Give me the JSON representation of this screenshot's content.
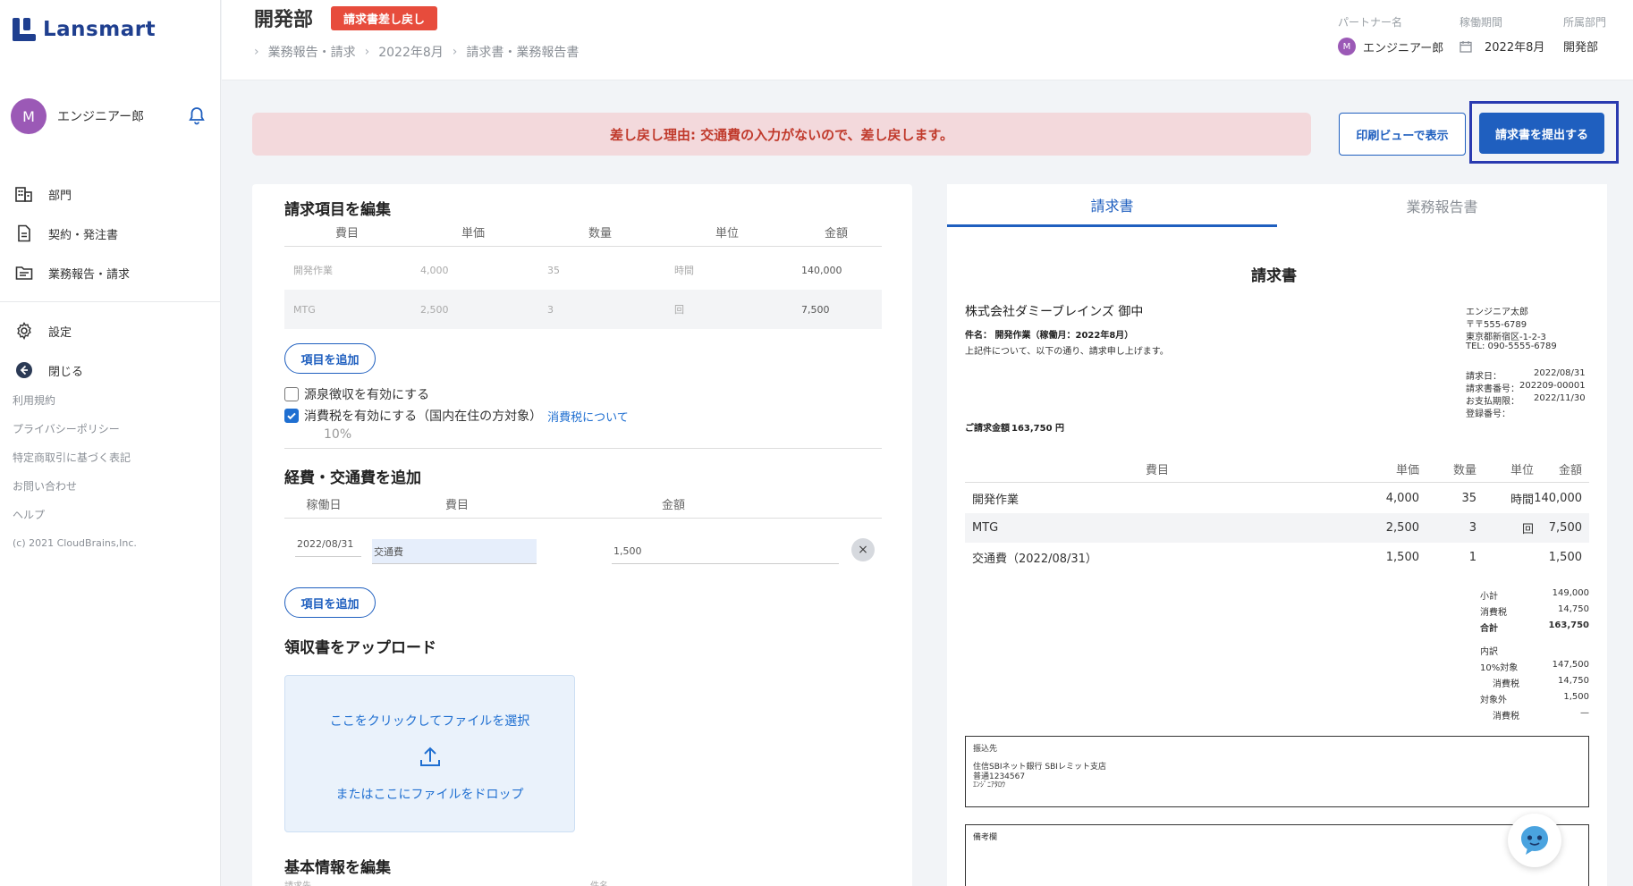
{
  "app": {
    "logo": "Lansmart"
  },
  "sidebar": {
    "user": {
      "initial": "M",
      "name": "エンジニアー郎"
    },
    "items": [
      {
        "label": "部門",
        "icon": "building-icon"
      },
      {
        "label": "契約・発注書",
        "icon": "document-icon"
      },
      {
        "label": "業務報告・請求",
        "icon": "folder-icon"
      },
      {
        "label": "設定",
        "icon": "gear-icon"
      },
      {
        "label": "閉じる",
        "icon": "arrow-left-icon"
      }
    ],
    "footer": [
      "利用規約",
      "プライバシーポリシー",
      "特定商取引に基づく表記",
      "お問い合わせ",
      "ヘルプ"
    ],
    "copyright": "(c) 2021 CloudBrains,Inc."
  },
  "header": {
    "title": "開発部",
    "status_badge": "請求書差し戻し",
    "breadcrumb": [
      "業務報告・請求",
      "2022年8月",
      "請求書・業務報告書"
    ],
    "partner_label": "パートナー名",
    "partner_initial": "M",
    "partner_name": "エンジニアー郎",
    "period_label": "稼働期間",
    "period_value": "2022年8月",
    "dept_label": "所属部門",
    "dept_value": "開発部"
  },
  "alert": {
    "text": "差し戻し理由: 交通費の入力がないので、差し戻します。"
  },
  "actions": {
    "print_view": "印刷ビューで表示",
    "submit": "請求書を提出する"
  },
  "edit_items": {
    "title": "請求項目を編集",
    "columns": [
      "費目",
      "単価",
      "数量",
      "単位",
      "金額"
    ],
    "rows": [
      {
        "item": "開発作業",
        "price": "4,000",
        "qty": "35",
        "unit": "時間",
        "amount": "140,000"
      },
      {
        "item": "MTG",
        "price": "2,500",
        "qty": "3",
        "unit": "回",
        "amount": "7,500"
      }
    ],
    "add_button": "項目を追加",
    "withholding_label": "源泉徴収を有効にする",
    "withholding_checked": false,
    "tax_label": "消費税を有効にする（国内在住の方対象）",
    "tax_checked": true,
    "tax_link": "消費税について",
    "tax_rate": "10%"
  },
  "expenses": {
    "title": "経費・交通費を追加",
    "columns": [
      "稼働日",
      "費目",
      "金額"
    ],
    "row": {
      "date": "2022/08/31",
      "item": "交通費",
      "amount": "1,500"
    },
    "add_button": "項目を追加"
  },
  "receipt": {
    "title": "領収書をアップロード",
    "click_text": "ここをクリックしてファイルを選択",
    "drop_text": "またはここにファイルをドロップ"
  },
  "basic_info": {
    "title": "基本情報を編集",
    "billing_to_label": "請求先",
    "subject_label": "件名"
  },
  "preview": {
    "tabs": [
      "請求書",
      "業務報告書"
    ],
    "doc_title": "請求書",
    "client": "株式会社ダミーブレインズ 御中",
    "subject": "件名： 開発作業（稼働月：2022年8月）",
    "intro": "上記件について、以下の通り、請求申し上げます。",
    "sender": [
      "エンジニア太郎",
      "〒〒555-6789",
      "東京都新宿区-1-2-3",
      "TEL: 090-5555-6789"
    ],
    "invoice_date_label": "請求日：",
    "invoice_date": "2022/08/31",
    "invoice_no_label": "請求書番号：",
    "invoice_no": "202209-00001",
    "due_label": "お支払期限：",
    "due_date": "2022/11/30",
    "reg_no_label": "登録番号：",
    "total_label": "ご請求金額",
    "total_value": "163,750 円",
    "columns": [
      "費目",
      "単価",
      "数量",
      "単位",
      "金額"
    ],
    "rows": [
      {
        "item": "開発作業",
        "price": "4,000",
        "qty": "35",
        "unit": "時間",
        "amount": "140,000"
      },
      {
        "item": "MTG",
        "price": "2,500",
        "qty": "3",
        "unit": "回",
        "amount": "7,500"
      },
      {
        "item": "交通費（2022/08/31）",
        "price": "1,500",
        "qty": "1",
        "unit": "",
        "amount": "1,500"
      }
    ],
    "subtotal_label": "小計",
    "subtotal": "149,000",
    "tax_label": "消費税",
    "tax": "14,750",
    "sum_label": "合計",
    "sum": "163,750",
    "breakdown_label": "内訳",
    "taxable10_label": "10%対象",
    "taxable10": "147,500",
    "taxable10_tax_label": "消費税",
    "taxable10_tax": "14,750",
    "exempt_label": "対象外",
    "exempt": "1,500",
    "exempt_tax_label": "消費税",
    "exempt_tax": "—",
    "bank_label": "振込先",
    "bank_lines": [
      "住信SBIネット銀行 SBIレミット支店",
      "普通1234567",
      "ｴﾝｼﾞﾆｱﾀﾛｳ"
    ],
    "notes_label": "備考欄"
  },
  "colors": {
    "brand": "#1f3f8f",
    "primary": "#1f5fbf",
    "danger": "#e74c3c",
    "alert_bg": "#f3d9dc"
  }
}
